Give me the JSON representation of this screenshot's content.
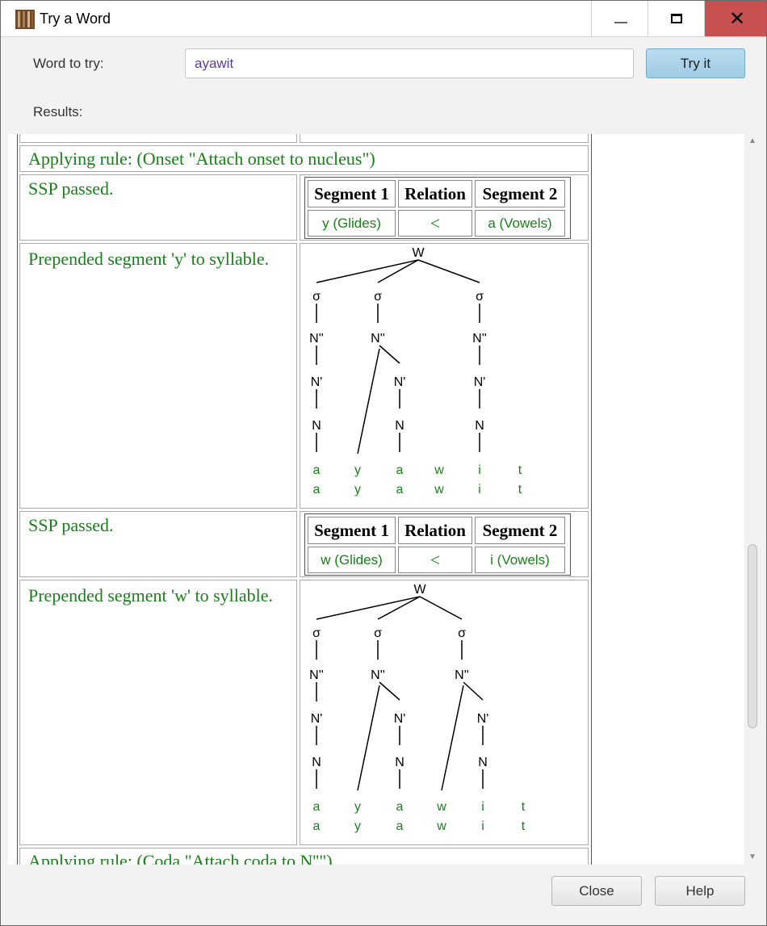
{
  "window": {
    "title": "Try a Word"
  },
  "form": {
    "word_label": "Word to try:",
    "word_value": "ayawit",
    "try_label": "Try it",
    "results_label": "Results:"
  },
  "results": {
    "rule1": "Applying rule: (Onset \"Attach onset to nucleus\")",
    "step1_ssp": "SSP passed.",
    "step1_table": {
      "h1": "Segment 1",
      "h2": "Relation",
      "h3": "Segment 2",
      "s1": "y (Glides)",
      "rel": "<",
      "s2": "a (Vowels)"
    },
    "step1_prepend": "Prepended segment 'y' to syllable.",
    "tree1": {
      "root": "W",
      "syllables": [
        "σ",
        "σ",
        "σ"
      ],
      "nodes": [
        "N''",
        "N'",
        "N"
      ],
      "segments_top": [
        "a",
        "y",
        "a",
        "w",
        "i",
        "t"
      ],
      "segments_bottom": [
        "a",
        "y",
        "a",
        "w",
        "i",
        "t"
      ]
    },
    "step2_ssp": "SSP passed.",
    "step2_table": {
      "h1": "Segment 1",
      "h2": "Relation",
      "h3": "Segment 2",
      "s1": "w (Glides)",
      "rel": "<",
      "s2": "i (Vowels)"
    },
    "step2_prepend": "Prepended segment 'w' to syllable.",
    "tree2": {
      "root": "W",
      "syllables": [
        "σ",
        "σ",
        "σ"
      ],
      "nodes": [
        "N''",
        "N'",
        "N"
      ],
      "segments_top": [
        "a",
        "y",
        "a",
        "w",
        "i",
        "t"
      ],
      "segments_bottom": [
        "a",
        "y",
        "a",
        "w",
        "i",
        "t"
      ]
    },
    "rule2": "Applying rule: (Coda \"Attach coda to N''\")"
  },
  "footer": {
    "close_label": "Close",
    "help_label": "Help"
  }
}
